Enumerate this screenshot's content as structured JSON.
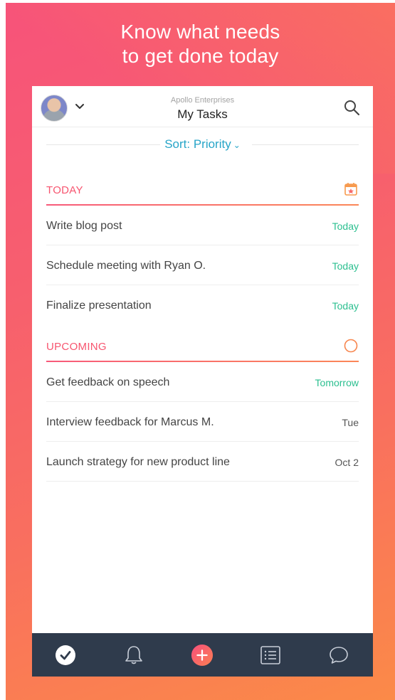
{
  "headline": {
    "line1": "Know what needs",
    "line2": "to get done today"
  },
  "header": {
    "organization": "Apollo Enterprises",
    "title": "My Tasks"
  },
  "sort": {
    "label": "Sort: Priority"
  },
  "sections": [
    {
      "label": "TODAY",
      "icon": "calendar-icon",
      "tasks": [
        {
          "name": "Write blog post",
          "due": "Today"
        },
        {
          "name": "Schedule meeting with Ryan O.",
          "due": "Today"
        },
        {
          "name": "Finalize presentation",
          "due": "Today"
        }
      ]
    },
    {
      "label": "UPCOMING",
      "icon": "circle-icon",
      "tasks": [
        {
          "name": "Get feedback on speech",
          "due": "Tomorrow"
        },
        {
          "name": "Interview feedback for Marcus M.",
          "due": "Tue"
        },
        {
          "name": "Launch strategy for new product line",
          "due": "Oct 2"
        }
      ]
    }
  ],
  "tabbar": [
    "check-circle-icon",
    "bell-icon",
    "add-icon",
    "list-icon",
    "chat-icon"
  ],
  "colors": {
    "accent": "#f7556f",
    "link": "#27a5c8",
    "due_green": "#2bbf8f",
    "tabbar_bg": "#2f3b4c"
  }
}
